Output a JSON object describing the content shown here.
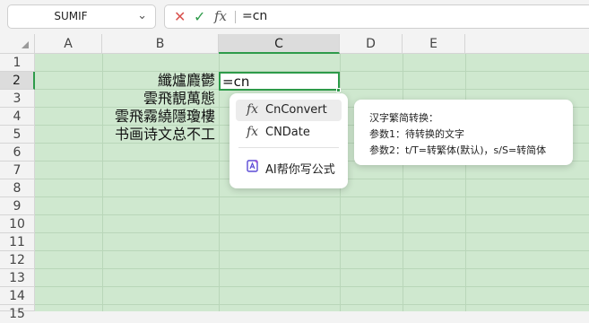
{
  "formula_bar": {
    "name_box": "SUMIF",
    "cancel_glyph": "✕",
    "confirm_glyph": "✓",
    "fx_glyph": "fx",
    "formula": "=cn"
  },
  "columns": [
    "A",
    "B",
    "C",
    "D",
    "E"
  ],
  "selected_column": "C",
  "rows": [
    "1",
    "2",
    "3",
    "4",
    "5",
    "6",
    "7",
    "8",
    "9",
    "10",
    "11",
    "12",
    "13",
    "14",
    "15"
  ],
  "selected_row": "2",
  "cells": {
    "B2": "纖爐麚鬱",
    "B3": "雲飛靚萬態",
    "B4": "雲飛霧繞隱瓊樓",
    "B5": "书画诗文总不工",
    "C2": "=cn"
  },
  "autocomplete": {
    "items": [
      {
        "icon": "fx",
        "label": "CnConvert",
        "highlighted": true
      },
      {
        "icon": "fx",
        "label": "CNDate",
        "highlighted": false
      }
    ],
    "ai_item": {
      "icon": "ai-sparkle-icon",
      "label": "AI帮你写公式"
    }
  },
  "tooltip": {
    "title": "汉字繁简转换：",
    "param1": "参数1：待转换的文字",
    "param2": "参数2：t/T=转繁体(默认)，s/S=转简体"
  },
  "colors": {
    "accent": "#2e9b4a",
    "sheet_background": "#cfe8cf",
    "cancel": "#d9534f"
  }
}
